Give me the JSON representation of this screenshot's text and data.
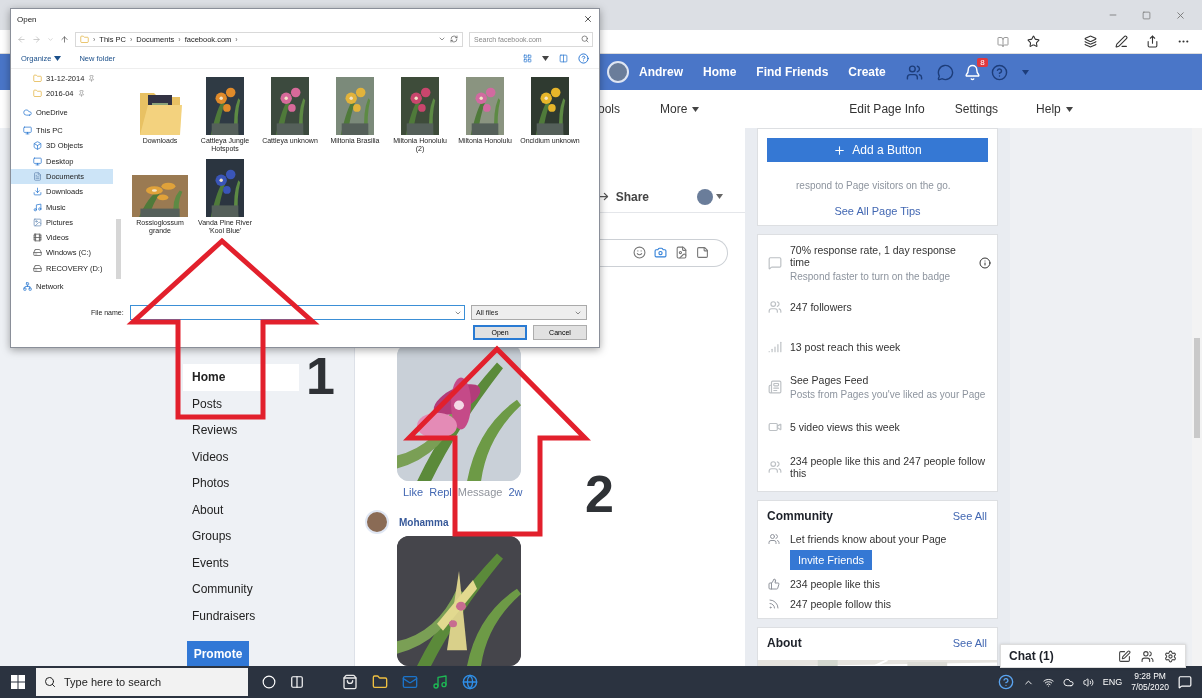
{
  "facebook": {
    "header": {
      "user": "Andrew",
      "links": [
        "Home",
        "Find Friends",
        "Create"
      ],
      "notification_badge": "8"
    },
    "page_nav": [
      {
        "label": "ools",
        "dropdown": false
      },
      {
        "label": "More",
        "dropdown": true
      },
      {
        "label": "Edit Page Info",
        "dropdown": false
      },
      {
        "label": "Settings",
        "dropdown": false
      },
      {
        "label": "Help",
        "dropdown": true
      }
    ],
    "left_nav": [
      {
        "label": "Home",
        "selected": true
      },
      {
        "label": "Posts",
        "selected": false
      },
      {
        "label": "Reviews",
        "selected": false
      },
      {
        "label": "Videos",
        "selected": false
      },
      {
        "label": "Photos",
        "selected": false
      },
      {
        "label": "About",
        "selected": false
      },
      {
        "label": "Groups",
        "selected": false
      },
      {
        "label": "Events",
        "selected": false
      },
      {
        "label": "Community",
        "selected": false
      },
      {
        "label": "Fundraisers",
        "selected": false
      }
    ],
    "promote_button": "Promote",
    "middle": {
      "share": "Share",
      "reply_actions": [
        "Like",
        "Repl",
        "Message"
      ],
      "reply_time": "2w",
      "next_author": "Mohamma"
    },
    "right": {
      "add_button": "Add a Button",
      "tips_text": "respond to Page visitors on the go.",
      "tips_link": "See All Page Tips",
      "stats": [
        {
          "kind": "response",
          "title": "70% response rate, 1 day response time",
          "subtitle": "Respond faster to turn on the badge"
        },
        {
          "kind": "followers",
          "title": "247 followers"
        },
        {
          "kind": "reach",
          "title": "13 post reach this week"
        },
        {
          "kind": "feed",
          "title": "See Pages Feed",
          "subtitle": "Posts from Pages you've liked as your Page"
        },
        {
          "kind": "video",
          "title": "5 video views this week"
        },
        {
          "kind": "people",
          "title": "234 people like this and 247 people follow this"
        }
      ],
      "community": {
        "title": "Community",
        "see_all": "See All",
        "invite_text": "Let friends know about your Page",
        "invite_button": "Invite Friends",
        "likes": "234 people like this",
        "follows": "247 people follow this"
      },
      "about": {
        "title": "About",
        "see_all": "See All"
      }
    },
    "chat": {
      "label": "Chat (1)"
    }
  },
  "dialog": {
    "title": "Open",
    "path": [
      "This PC",
      "Documents",
      "facebook.com"
    ],
    "path_separator": "›",
    "search_placeholder": "Search facebook.com",
    "organize": "Organize",
    "new_folder": "New folder",
    "nav_tree": [
      {
        "label": "31-12-2014",
        "kind": "folder",
        "pinned": true,
        "selected": false
      },
      {
        "label": "2016-04",
        "kind": "folder",
        "pinned": true,
        "selected": false
      },
      {
        "label": "OneDrive",
        "kind": "cloud",
        "pinned": false,
        "selected": false
      },
      {
        "label": "This PC",
        "kind": "pc",
        "pinned": false,
        "selected": false,
        "children": [
          {
            "label": "3D Objects",
            "kind": "objects",
            "pinned": false,
            "selected": false
          },
          {
            "label": "Desktop",
            "kind": "desktop",
            "pinned": false,
            "selected": false
          },
          {
            "label": "Documents",
            "kind": "documents",
            "pinned": false,
            "selected": true
          },
          {
            "label": "Downloads",
            "kind": "downloads",
            "pinned": false,
            "selected": false
          },
          {
            "label": "Music",
            "kind": "music",
            "pinned": false,
            "selected": false
          },
          {
            "label": "Pictures",
            "kind": "pictures",
            "pinned": false,
            "selected": false
          },
          {
            "label": "Videos",
            "kind": "videos",
            "pinned": false,
            "selected": false
          },
          {
            "label": "Windows (C:)",
            "kind": "drive",
            "pinned": false,
            "selected": false
          },
          {
            "label": "RECOVERY (D:)",
            "kind": "drive",
            "pinned": false,
            "selected": false
          }
        ]
      },
      {
        "label": "Network",
        "kind": "network",
        "pinned": false,
        "selected": false
      }
    ],
    "files": [
      {
        "name": "Downloads",
        "kind": "folder"
      },
      {
        "name": "Cattleya Jungle Hotspots",
        "kind": "picture"
      },
      {
        "name": "Cattleya unknown",
        "kind": "picture"
      },
      {
        "name": "Miltonia Brasilia",
        "kind": "picture"
      },
      {
        "name": "Miltonia Honolulu (2)",
        "kind": "picture"
      },
      {
        "name": "Miltonia Honolulu",
        "kind": "picture"
      },
      {
        "name": "Oncidium unknown",
        "kind": "picture"
      },
      {
        "name": "Rossioglossum grande",
        "kind": "picture"
      },
      {
        "name": "Vanda Pine River 'Kool Blue'",
        "kind": "picture"
      }
    ],
    "file_name_label": "File name:",
    "file_type": "All files",
    "buttons": [
      {
        "label": "Open",
        "default": true
      },
      {
        "label": "Cancel",
        "default": false
      }
    ]
  },
  "annotations": [
    {
      "label": "1"
    },
    {
      "label": "2"
    }
  ],
  "taskbar": {
    "search_placeholder": "Type here to search",
    "language": "ENG",
    "time": "9:28 PM",
    "date": "7/05/2020"
  }
}
